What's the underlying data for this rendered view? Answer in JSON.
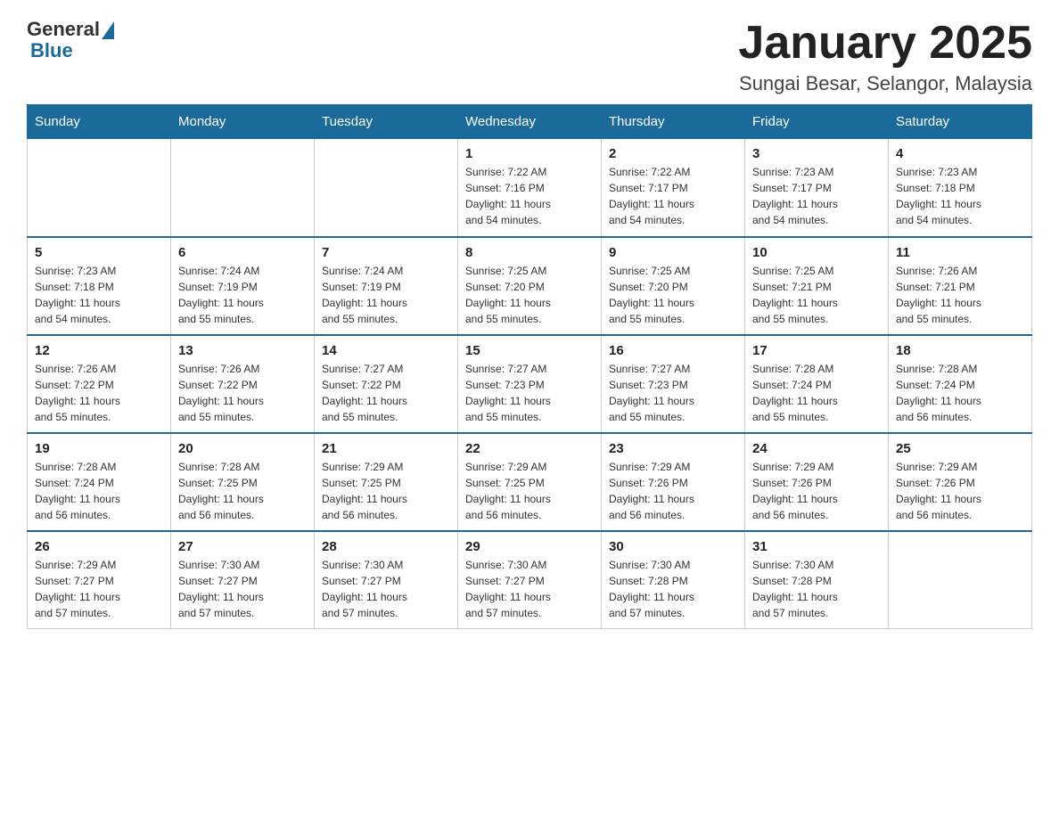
{
  "logo": {
    "general": "General",
    "blue": "Blue"
  },
  "title": "January 2025",
  "location": "Sungai Besar, Selangor, Malaysia",
  "days_of_week": [
    "Sunday",
    "Monday",
    "Tuesday",
    "Wednesday",
    "Thursday",
    "Friday",
    "Saturday"
  ],
  "weeks": [
    [
      {
        "day": "",
        "info": ""
      },
      {
        "day": "",
        "info": ""
      },
      {
        "day": "",
        "info": ""
      },
      {
        "day": "1",
        "info": "Sunrise: 7:22 AM\nSunset: 7:16 PM\nDaylight: 11 hours\nand 54 minutes."
      },
      {
        "day": "2",
        "info": "Sunrise: 7:22 AM\nSunset: 7:17 PM\nDaylight: 11 hours\nand 54 minutes."
      },
      {
        "day": "3",
        "info": "Sunrise: 7:23 AM\nSunset: 7:17 PM\nDaylight: 11 hours\nand 54 minutes."
      },
      {
        "day": "4",
        "info": "Sunrise: 7:23 AM\nSunset: 7:18 PM\nDaylight: 11 hours\nand 54 minutes."
      }
    ],
    [
      {
        "day": "5",
        "info": "Sunrise: 7:23 AM\nSunset: 7:18 PM\nDaylight: 11 hours\nand 54 minutes."
      },
      {
        "day": "6",
        "info": "Sunrise: 7:24 AM\nSunset: 7:19 PM\nDaylight: 11 hours\nand 55 minutes."
      },
      {
        "day": "7",
        "info": "Sunrise: 7:24 AM\nSunset: 7:19 PM\nDaylight: 11 hours\nand 55 minutes."
      },
      {
        "day": "8",
        "info": "Sunrise: 7:25 AM\nSunset: 7:20 PM\nDaylight: 11 hours\nand 55 minutes."
      },
      {
        "day": "9",
        "info": "Sunrise: 7:25 AM\nSunset: 7:20 PM\nDaylight: 11 hours\nand 55 minutes."
      },
      {
        "day": "10",
        "info": "Sunrise: 7:25 AM\nSunset: 7:21 PM\nDaylight: 11 hours\nand 55 minutes."
      },
      {
        "day": "11",
        "info": "Sunrise: 7:26 AM\nSunset: 7:21 PM\nDaylight: 11 hours\nand 55 minutes."
      }
    ],
    [
      {
        "day": "12",
        "info": "Sunrise: 7:26 AM\nSunset: 7:22 PM\nDaylight: 11 hours\nand 55 minutes."
      },
      {
        "day": "13",
        "info": "Sunrise: 7:26 AM\nSunset: 7:22 PM\nDaylight: 11 hours\nand 55 minutes."
      },
      {
        "day": "14",
        "info": "Sunrise: 7:27 AM\nSunset: 7:22 PM\nDaylight: 11 hours\nand 55 minutes."
      },
      {
        "day": "15",
        "info": "Sunrise: 7:27 AM\nSunset: 7:23 PM\nDaylight: 11 hours\nand 55 minutes."
      },
      {
        "day": "16",
        "info": "Sunrise: 7:27 AM\nSunset: 7:23 PM\nDaylight: 11 hours\nand 55 minutes."
      },
      {
        "day": "17",
        "info": "Sunrise: 7:28 AM\nSunset: 7:24 PM\nDaylight: 11 hours\nand 55 minutes."
      },
      {
        "day": "18",
        "info": "Sunrise: 7:28 AM\nSunset: 7:24 PM\nDaylight: 11 hours\nand 56 minutes."
      }
    ],
    [
      {
        "day": "19",
        "info": "Sunrise: 7:28 AM\nSunset: 7:24 PM\nDaylight: 11 hours\nand 56 minutes."
      },
      {
        "day": "20",
        "info": "Sunrise: 7:28 AM\nSunset: 7:25 PM\nDaylight: 11 hours\nand 56 minutes."
      },
      {
        "day": "21",
        "info": "Sunrise: 7:29 AM\nSunset: 7:25 PM\nDaylight: 11 hours\nand 56 minutes."
      },
      {
        "day": "22",
        "info": "Sunrise: 7:29 AM\nSunset: 7:25 PM\nDaylight: 11 hours\nand 56 minutes."
      },
      {
        "day": "23",
        "info": "Sunrise: 7:29 AM\nSunset: 7:26 PM\nDaylight: 11 hours\nand 56 minutes."
      },
      {
        "day": "24",
        "info": "Sunrise: 7:29 AM\nSunset: 7:26 PM\nDaylight: 11 hours\nand 56 minutes."
      },
      {
        "day": "25",
        "info": "Sunrise: 7:29 AM\nSunset: 7:26 PM\nDaylight: 11 hours\nand 56 minutes."
      }
    ],
    [
      {
        "day": "26",
        "info": "Sunrise: 7:29 AM\nSunset: 7:27 PM\nDaylight: 11 hours\nand 57 minutes."
      },
      {
        "day": "27",
        "info": "Sunrise: 7:30 AM\nSunset: 7:27 PM\nDaylight: 11 hours\nand 57 minutes."
      },
      {
        "day": "28",
        "info": "Sunrise: 7:30 AM\nSunset: 7:27 PM\nDaylight: 11 hours\nand 57 minutes."
      },
      {
        "day": "29",
        "info": "Sunrise: 7:30 AM\nSunset: 7:27 PM\nDaylight: 11 hours\nand 57 minutes."
      },
      {
        "day": "30",
        "info": "Sunrise: 7:30 AM\nSunset: 7:28 PM\nDaylight: 11 hours\nand 57 minutes."
      },
      {
        "day": "31",
        "info": "Sunrise: 7:30 AM\nSunset: 7:28 PM\nDaylight: 11 hours\nand 57 minutes."
      },
      {
        "day": "",
        "info": ""
      }
    ]
  ]
}
